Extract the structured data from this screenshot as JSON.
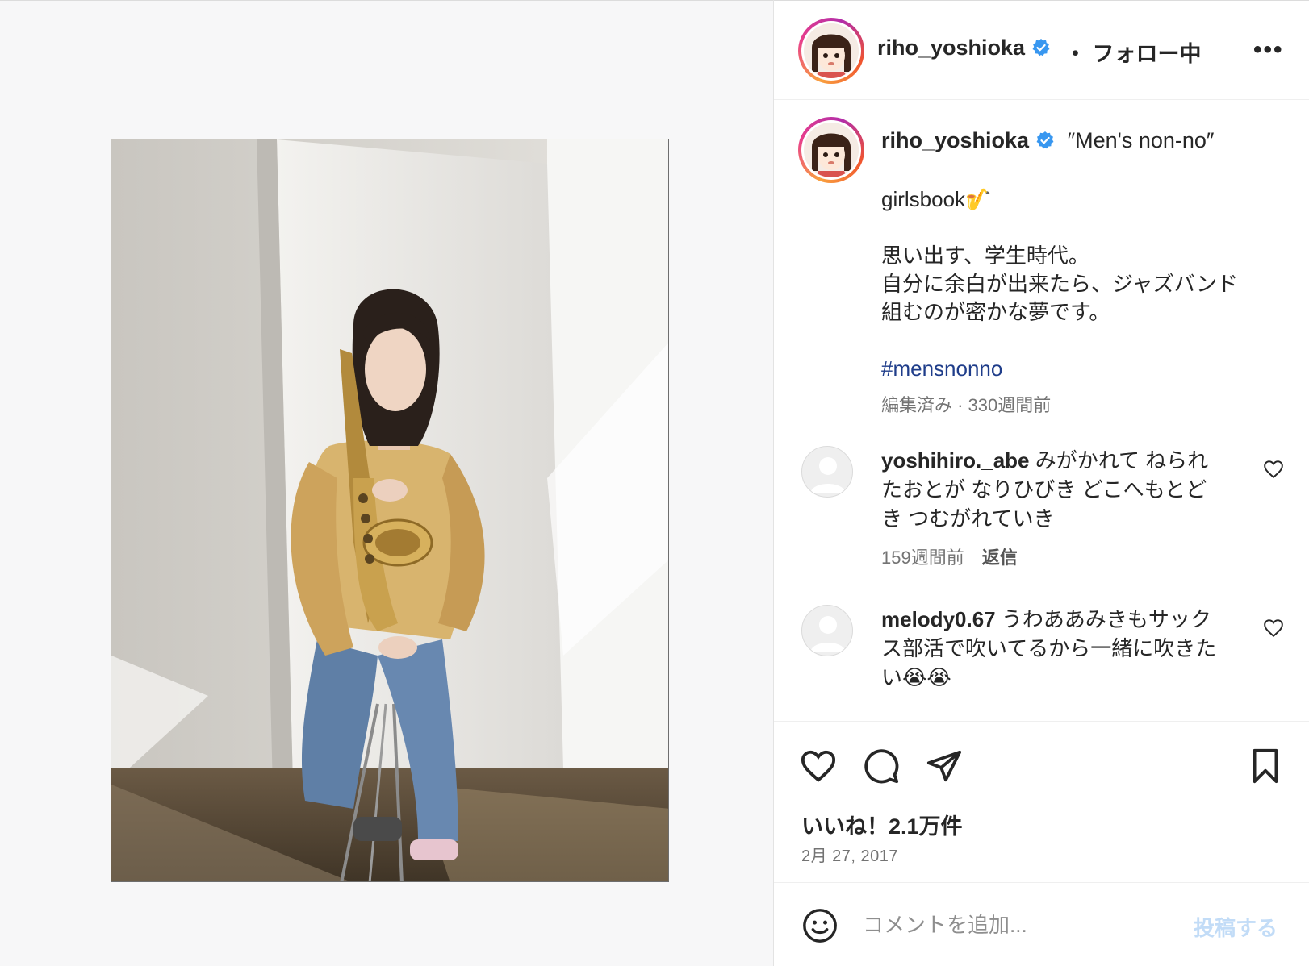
{
  "post": {
    "username": "riho_yoshioka",
    "follow_status": "・ フォロー中",
    "more_icon": "more-horizontal-icon",
    "photo_alt": "",
    "caption": {
      "title": "″Men's non-no″",
      "line1": "girlsbook🎷",
      "line2": "思い出す、学生時代。",
      "line3": "自分に余白が出来たら、ジャズバンド",
      "line4": "組むのが密かな夢です。",
      "hashtag": "#mensnonno",
      "meta": "編集済み · 330週間前"
    },
    "comments": [
      {
        "username": "yoshihiro._abe",
        "text_part1": " みがかれて ねられ",
        "text_part2": "たおとが なりひびき どこへもとど",
        "text_part3": "き つむがれていき",
        "time": "159週間前",
        "reply": "返信"
      },
      {
        "username": "melody0.67",
        "text_part1": " うわああみきもサック",
        "text_part2": "ス部活で吹いてるから一緒に吹きた",
        "text_part3": "い😭😭"
      }
    ],
    "likes": "いいね！2.1万件",
    "date": "2月 27, 2017"
  },
  "comment_bar": {
    "placeholder": "コメントを追加...",
    "post_button": "投稿する"
  },
  "colors": {
    "hashtag": "#1f3d8a",
    "verified": "#3897f0",
    "post_button_disabled": "#c2dcf7"
  }
}
